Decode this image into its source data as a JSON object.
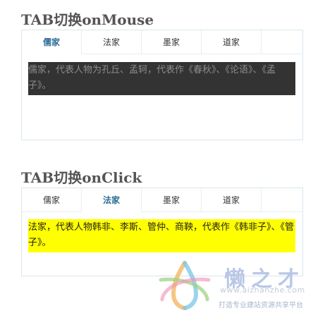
{
  "sections": [
    {
      "heading": "TAB切换onMouse",
      "tabs": [
        "儒家",
        "法家",
        "墨家",
        "道家"
      ],
      "active_tab": 0,
      "content": "儒家，代表人物为孔丘、孟轲，代表作《春秋》、《论语》、《孟子》。",
      "content_bg": "#333333",
      "content_color": "#8c8c8c"
    },
    {
      "heading": "TAB切换onClick",
      "tabs": [
        "儒家",
        "法家",
        "墨家",
        "道家"
      ],
      "active_tab": 1,
      "content": "法家，代表人物韩非、李斯、管仲、商鞅，代表作《韩非子》、《管子》。",
      "content_bg": "#ffff00",
      "content_color": "#222222"
    }
  ],
  "watermark": {
    "brand": "懒之才",
    "url": "www.aizhanzhe.com",
    "slogan": "打造专业建站资源共享平台"
  },
  "colors": {
    "active_tab": "#2d6e98",
    "panel_border": "#d8e6ee"
  }
}
